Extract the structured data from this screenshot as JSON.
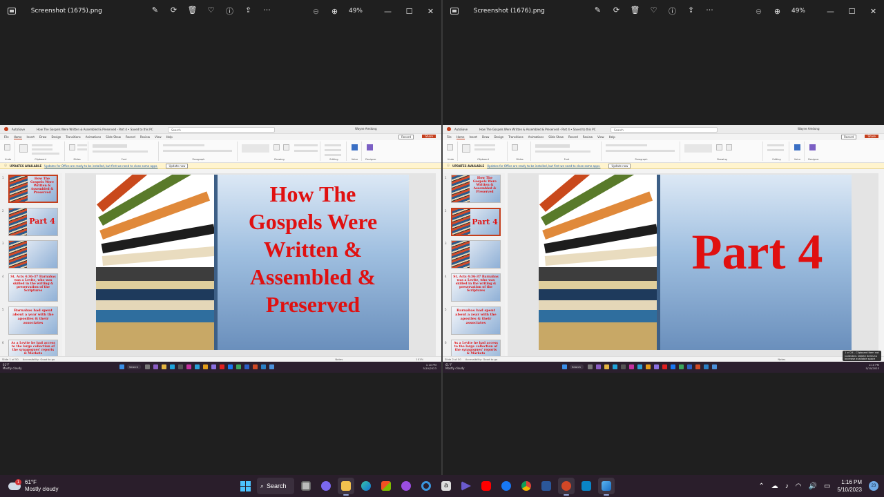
{
  "left_viewer": {
    "filename": "Screenshot (1675).png",
    "zoom": "49%",
    "slide_title": "How The Gospels Were Written & Assembled & Preserved",
    "slide_title_lines": [
      "How The",
      "Gospels Were",
      "Written &",
      "Assembled &",
      "Preserved"
    ],
    "status": "Slide 1 of 50"
  },
  "right_viewer": {
    "filename": "Screenshot (1676).png",
    "zoom": "49%",
    "slide_title": "Part 4",
    "status": "Slide 2 of 50",
    "toast": "1 of 24 - Clipboard Item not Collected. Delete items to increase available space"
  },
  "ppt": {
    "autosave": "AutoSave",
    "doc_title": "How The Gospels Were Written & Assembled & Preserved - Part 4 • Saved to this PC",
    "search": "Search",
    "user": "Wayne Amdong",
    "tabs": [
      "File",
      "Home",
      "Insert",
      "Draw",
      "Design",
      "Transitions",
      "Animations",
      "Slide Show",
      "Record",
      "Review",
      "View",
      "Help"
    ],
    "record": "Record",
    "share": "Share",
    "groups": [
      "Undo",
      "Clipboard",
      "Slides",
      "Font",
      "Paragraph",
      "Drawing",
      "Editing",
      "Voice",
      "Designer"
    ],
    "update_label": "UPDATES AVAILABLE",
    "update_text": "Updates for Office are ready to be installed, but first we need to close some apps.",
    "update_button": "Update now",
    "accessibility": "Accessibility: Good to go",
    "notes": "Notes",
    "zoom_pct": "101%",
    "weather_small": "61°F",
    "weather_small_desc": "Mostly cloudy",
    "search_small": "Search",
    "time_small": "1:10 PM",
    "date_small": "5/10/2023",
    "thumb_labels": [
      "How The Gospels Were Written & Assembled & Preserved",
      "Part 4",
      "",
      "St. Acts 4:36-37 Barnabas was a Levite, who was skilled in the writing & preservation of the Scriptures",
      "Barnabas had spent about a year with the apostles & their associates",
      "As a Levite he had access to the large collection of the synagogues' reports & Markets"
    ]
  },
  "taskbar": {
    "temp": "61°F",
    "weather": "Mostly cloudy",
    "weather_badge": "1",
    "search": "Search",
    "time": "1:16 PM",
    "date": "5/10/2023",
    "notif_count": "23"
  }
}
